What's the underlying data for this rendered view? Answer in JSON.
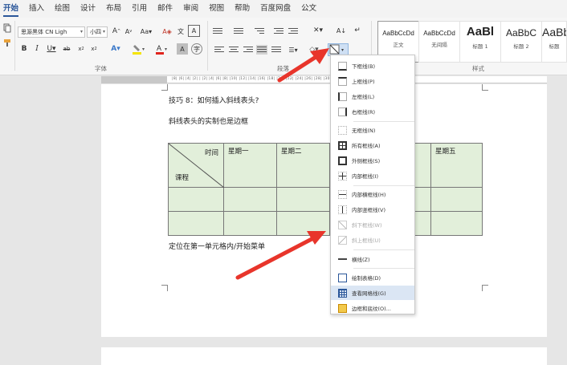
{
  "tabs": [
    "开始",
    "插入",
    "绘图",
    "设计",
    "布局",
    "引用",
    "邮件",
    "审阅",
    "视图",
    "帮助",
    "百度网盘",
    "公文"
  ],
  "ribbon": {
    "font_name": "思源黑体 CN Ligh",
    "font_size": "小四",
    "font_group_label": "字体",
    "paragraph_group_label": "段落",
    "styles_group_label": "样式",
    "styles": [
      {
        "sample": "AaBbCcDd",
        "name": "正文"
      },
      {
        "sample": "AaBbCcDd",
        "name": "无间隔"
      },
      {
        "sample": "AaBl",
        "name": "标题 1"
      },
      {
        "sample": "AaBbC",
        "name": "标题 2"
      },
      {
        "sample": "AaBb",
        "name": "标题"
      }
    ]
  },
  "ruler": {
    "ticks": "|8| |6| |4| |2| |  |2| |4| |6| |8| |10| |12| |14| |16| |18| |20| |22| |24| |26| |28| |30| |32| |34| |36| |38| |40|"
  },
  "document": {
    "heading": "技巧 8：如何插入斜线表头?",
    "subheading": "斜线表头的实制也是边框",
    "table": {
      "diag_top": "时间",
      "diag_bottom": "课程",
      "headers": [
        "星期一",
        "星期二",
        "",
        "",
        "星期五"
      ]
    },
    "footer_text": "定位在第一单元格内/开始菜单"
  },
  "border_menu": {
    "items": [
      "下框线(B)",
      "上框线(P)",
      "左框线(L)",
      "右框线(R)",
      "无框线(N)",
      "所有框线(A)",
      "外侧框线(S)",
      "内部框线(I)",
      "内部横框线(H)",
      "内部竖框线(V)",
      "斜下框线(W)",
      "斜上框线(U)",
      "横线(Z)",
      "绘制表格(D)",
      "查看网格线(G)",
      "边框和底纹(O)..."
    ]
  },
  "colors": {
    "accent": "#2b579a",
    "table_fill": "#e2efda",
    "arrow": "#e8352b"
  }
}
